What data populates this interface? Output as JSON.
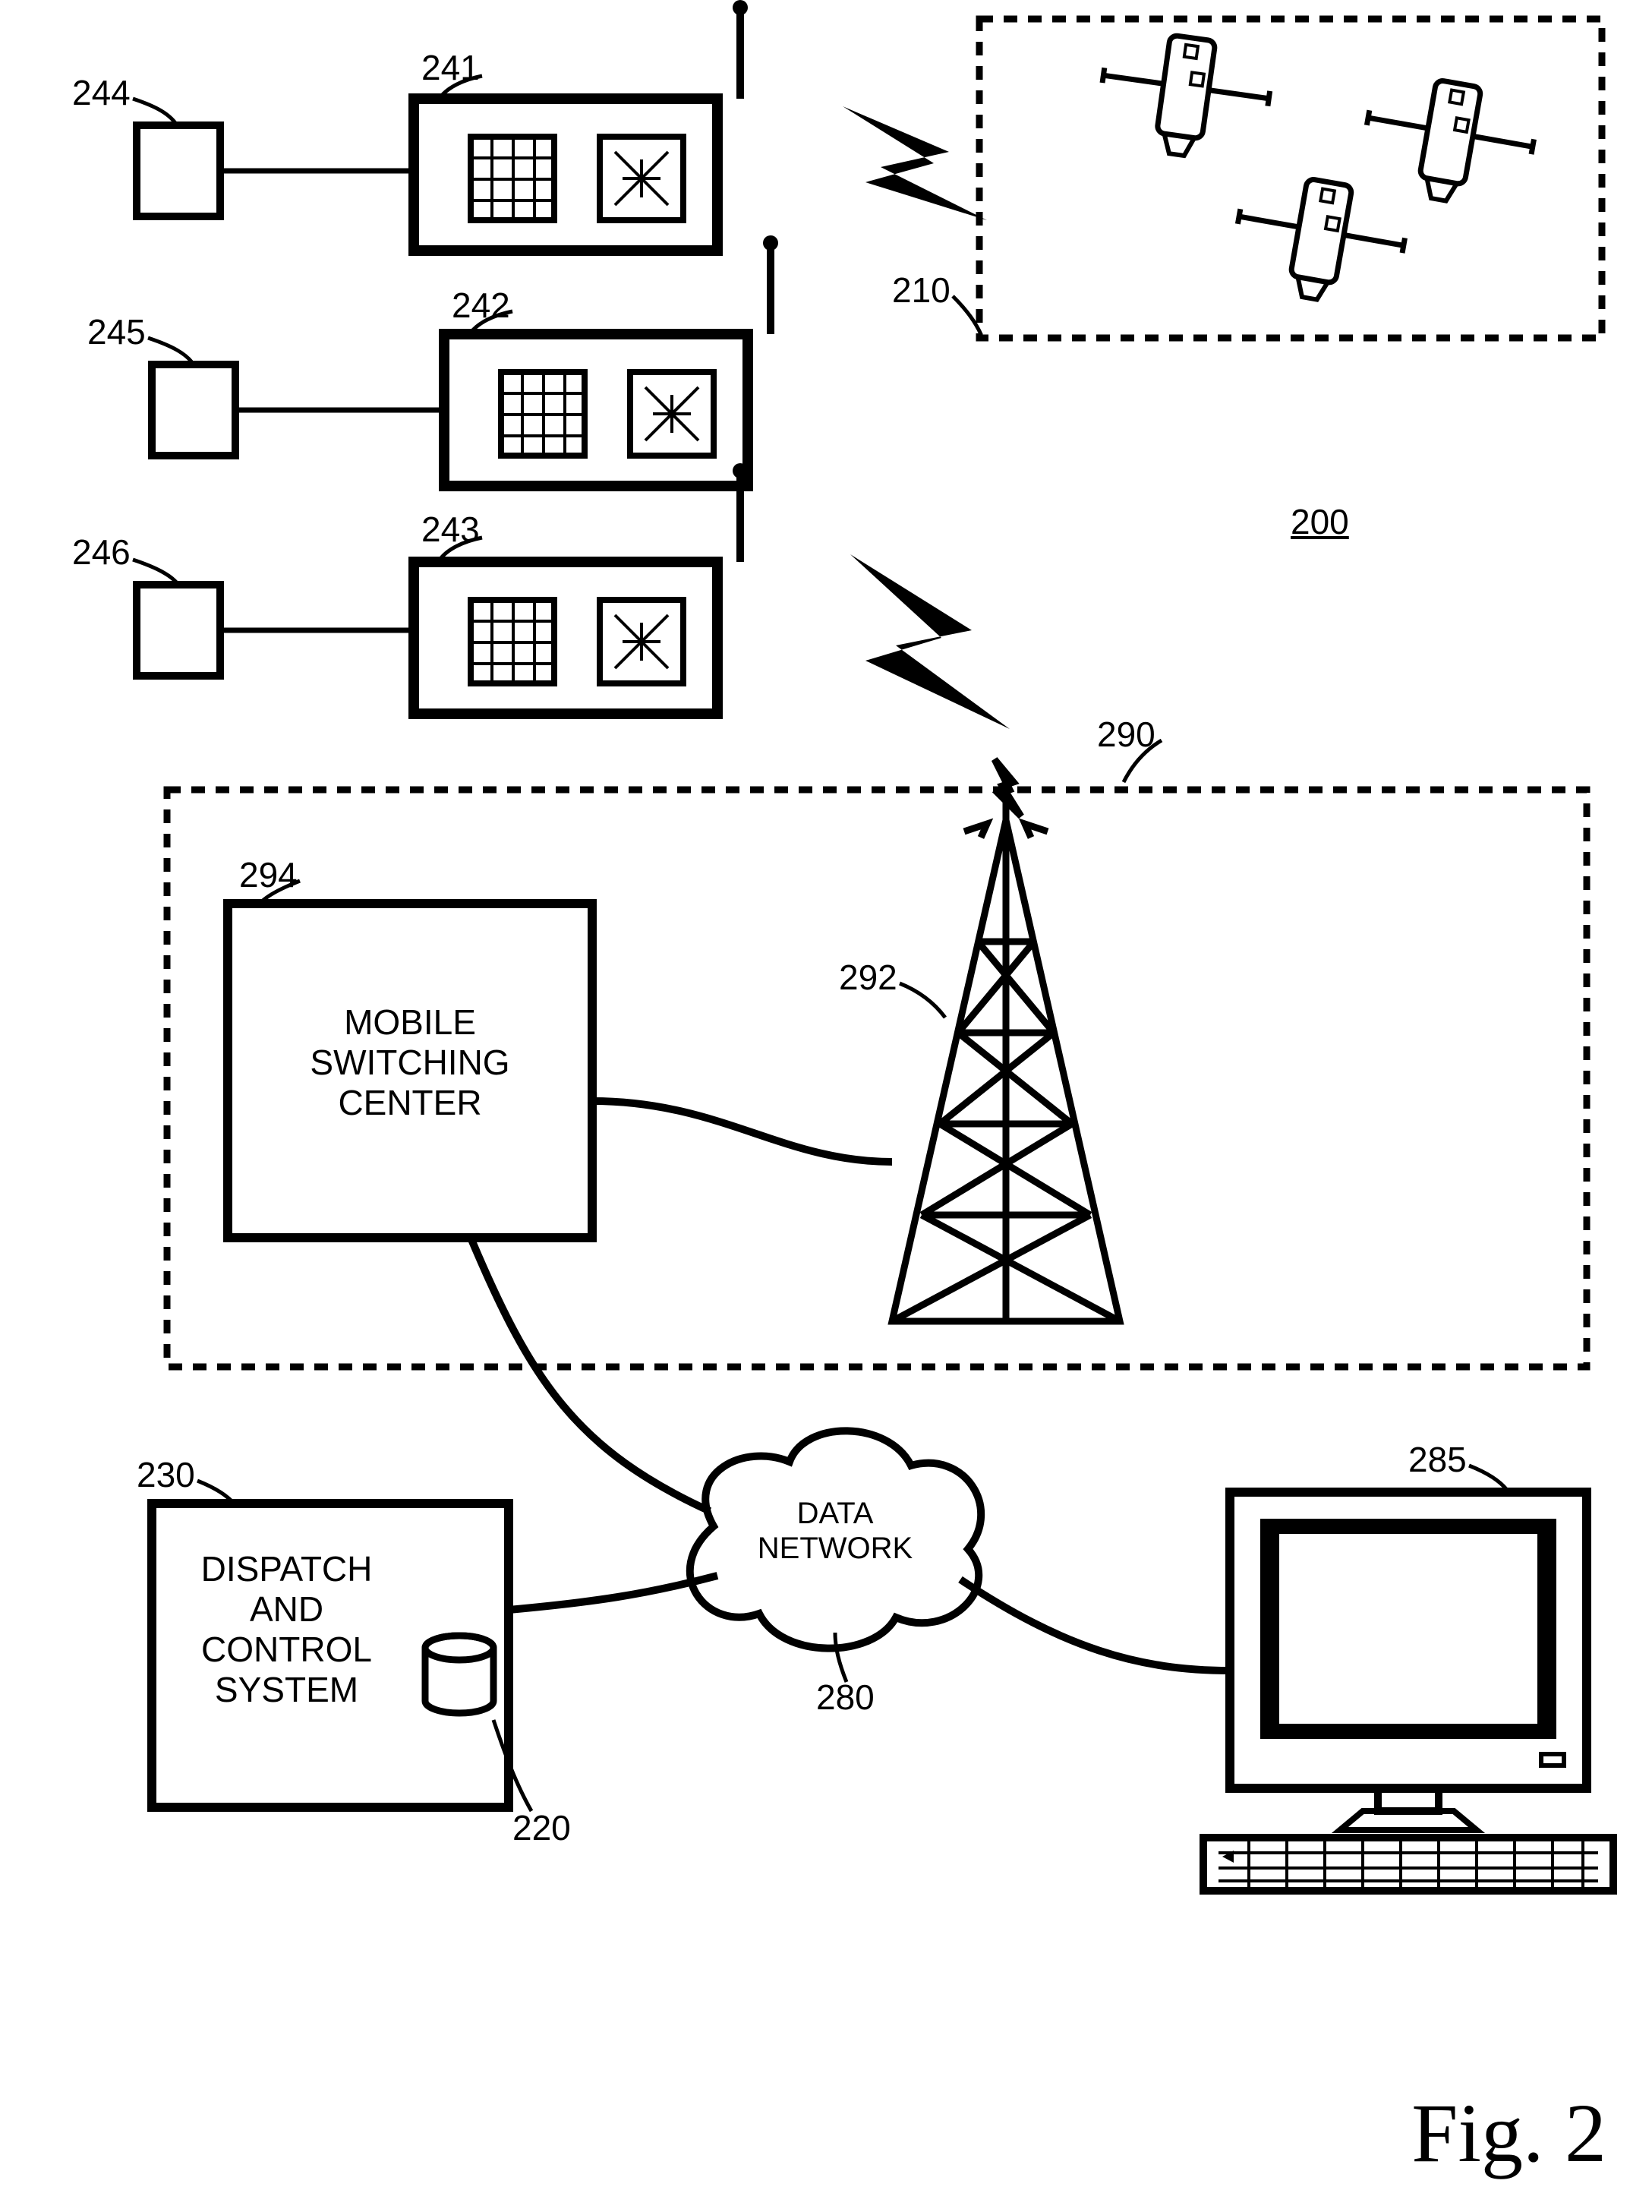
{
  "figure_label": "Fig. 2",
  "figure_ref": "200",
  "refs": {
    "satellites": "210",
    "wireless_network": "290",
    "cell_tower": "292",
    "msc": "294",
    "data_network": "280",
    "dispatch": "230",
    "database": "220",
    "terminal": "285",
    "device1": "241",
    "device2": "242",
    "device3": "243",
    "sensor1": "244",
    "sensor2": "245",
    "sensor3": "246"
  },
  "labels": {
    "msc": "MOBILE\nSWITCHING\nCENTER",
    "dispatch": "DISPATCH\nAND\nCONTROL\nSYSTEM",
    "data_network": "DATA\nNETWORK"
  }
}
